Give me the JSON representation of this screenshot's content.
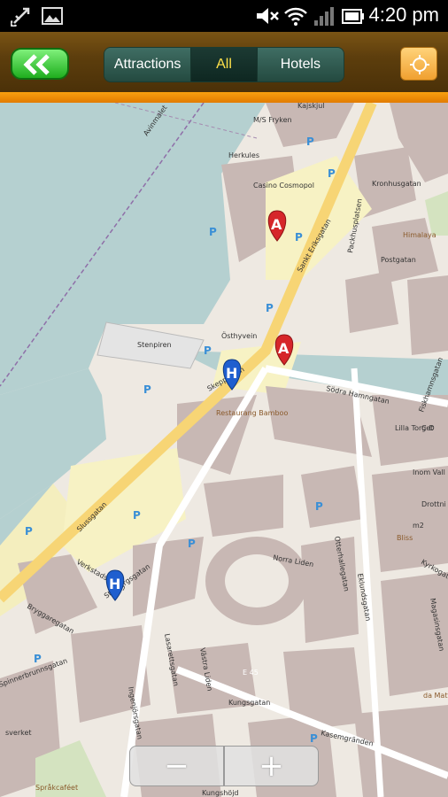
{
  "status_bar": {
    "time": "4:20 pm",
    "icons": [
      "usb-icon",
      "image-icon",
      "mute-icon",
      "wifi-icon",
      "signal-icon",
      "battery-icon"
    ]
  },
  "toolbar": {
    "back_icon": "double-chevron-left-icon",
    "tabs": [
      {
        "label": "Attractions",
        "selected": false
      },
      {
        "label": "All",
        "selected": true
      },
      {
        "label": "Hotels",
        "selected": false
      }
    ],
    "locate_icon": "crosshair-icon"
  },
  "map": {
    "street_labels": {
      "avinmalet": "Avinmalet",
      "kajskjul": "Kajskjul",
      "ms_fryken": "M/S Fryken",
      "herkules": "Herkules",
      "casino": "Casino Cosmopol",
      "kronhusgatan": "Kronhusgatan",
      "himalaya": "Himalaya",
      "postgatan": "Postgatan",
      "packhusplatsen": "Packhusplatsen",
      "sankt_eriksgatan": "Sankt Eriksgatan",
      "stenpiren": "Stenpiren",
      "osthyvein": "Östhyvein",
      "skeppsbron": "Skeppsbron",
      "restaurang_bamboo": "Restaurang Bamboo",
      "sodra_hamngatan": "Södra Hamngatan",
      "lilla_torget": "Lilla Torget",
      "slussgatan": "Slussgatan",
      "verkstadsgatan": "Verkstadsgatan",
      "norra_liden": "Norra Liden",
      "otterhallegatan": "Otterhallegatan",
      "bliss": "Bliss",
      "drottning": "Drottni",
      "bryggaregatan": "Bryggaregatan",
      "stigbergsgatan": "Stigbergsgatan",
      "lasarettsgatan": "Lasarettsgatan",
      "vastra_liden": "Västra Liden",
      "ingenjorsgatan": "Ingenjörsgatan",
      "kungsgatan": "Kungsgatan",
      "kasemgranden": "Kasemgränden",
      "kyrkogatan": "Kyrkogatan",
      "magasinsgatan": "Magasinsgatan",
      "da_matteo": "da Matteo Panetteria",
      "sprakcafeet": "Språkcaféet",
      "kungshojd": "Kungshöjd",
      "e45": "E 45",
      "m2": "m2",
      "spinnerbrunnsgatan": "Spinnerbrunnsgatan",
      "eklundsgatan": "Eklundsgatan",
      "sverket": "sverket",
      "inom_vall": "Inom Vall",
      "c_d": "C-D",
      "fiskhamnsgatan": "Fiskhamnsgatan"
    },
    "markers": [
      {
        "letter": "A",
        "type": "attraction",
        "color": "#d6262a"
      },
      {
        "letter": "A",
        "type": "attraction",
        "color": "#d6262a"
      },
      {
        "letter": "H",
        "type": "hotel",
        "color": "#1f5fcf"
      },
      {
        "letter": "H",
        "type": "hotel",
        "color": "#1f5fcf"
      }
    ],
    "parking_letter": "P",
    "colors": {
      "water": "#b5d0d0",
      "land": "#eee9e2",
      "building": "#c8b8b4",
      "park": "#d4e3c0",
      "plaza": "#f7f2c4"
    }
  },
  "zoom": {
    "out_symbol": "−",
    "in_symbol": "+"
  }
}
